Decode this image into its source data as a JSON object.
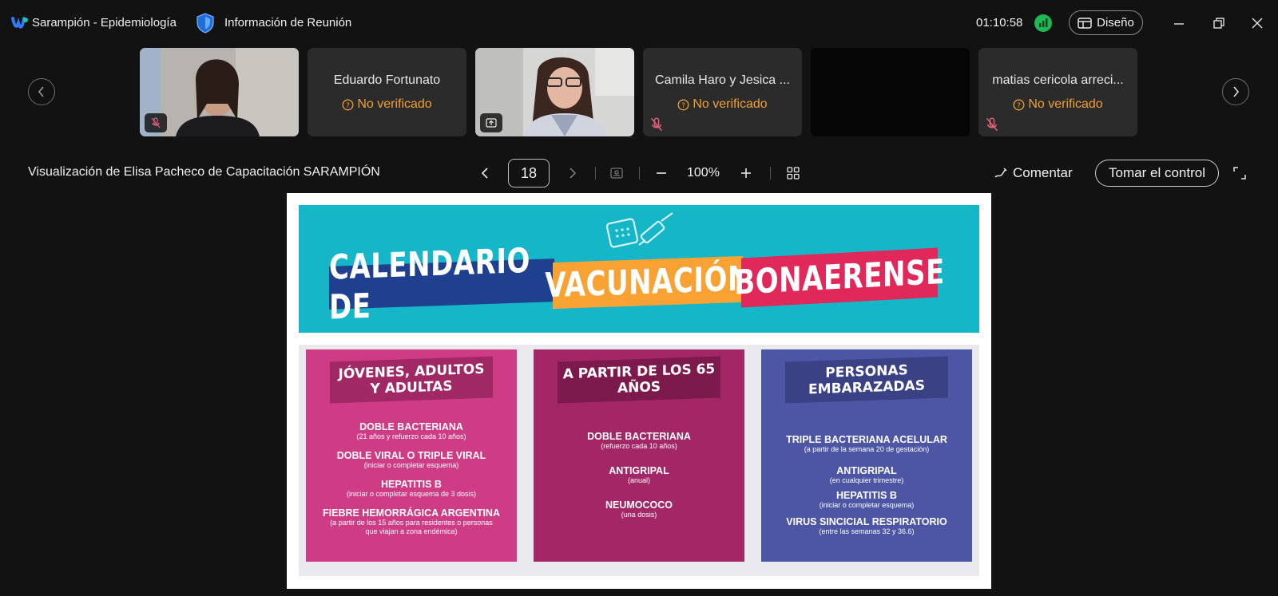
{
  "titlebar": {
    "app_title": "Sarampión - Epidemiología",
    "meeting_info": "Información de Reunión",
    "timer": "01:10:58",
    "layout_label": "Diseño"
  },
  "participants": [
    {
      "name": "",
      "status": "",
      "type": "video"
    },
    {
      "name": "Eduardo Fortunato",
      "status": "No verificado",
      "type": "name"
    },
    {
      "name": "",
      "status": "",
      "type": "video"
    },
    {
      "name": "Camila Haro y Jesica ...",
      "status": "No verificado",
      "type": "name"
    },
    {
      "name": "",
      "status": "",
      "type": "black"
    },
    {
      "name": "matias cericola  arreci...",
      "status": "No verificado",
      "type": "name"
    }
  ],
  "share": {
    "title": "Visualización de Elisa Pacheco de Capacitación SARAMPIÓN",
    "page": "18",
    "zoom": "100%",
    "comment_label": "Comentar",
    "control_label": "Tomar el control"
  },
  "slide": {
    "banner": [
      "CALENDARIO DE",
      "VACUNACIÓN",
      "BONAERENSE"
    ],
    "columns": [
      {
        "heading": "JÓVENES, ADULTOS Y ADULTAS",
        "items": [
          {
            "title": "DOBLE BACTERIANA",
            "note": "(21 años y refuerzo cada 10 años)"
          },
          {
            "title": "DOBLE VIRAL O TRIPLE VIRAL",
            "note": "(iniciar o completar esquema)"
          },
          {
            "title": "HEPATITIS B",
            "note": "(iniciar o completar esquema de 3 dosis)"
          },
          {
            "title": "FIEBRE HEMORRÁGICA ARGENTINA",
            "note": "(a partir de los 15 años para residentes o personas que viajan a zona endémica)"
          }
        ]
      },
      {
        "heading": "A PARTIR DE LOS 65 AÑOS",
        "items": [
          {
            "title": "DOBLE BACTERIANA",
            "note": "(refuerzo cada 10 años)"
          },
          {
            "title": "ANTIGRIPAL",
            "note": "(anual)"
          },
          {
            "title": "NEUMOCOCO",
            "note": "(una dosis)"
          }
        ]
      },
      {
        "heading": "PERSONAS EMBARAZADAS",
        "items": [
          {
            "title": "TRIPLE BACTERIANA ACELULAR",
            "note": "(a partir de la semana 20 de gestación)"
          },
          {
            "title": "ANTIGRIPAL",
            "note": "(en cualquier trimestre)"
          },
          {
            "title": "HEPATITIS B",
            "note": "(iniciar o completar esquema)"
          },
          {
            "title": "VIRUS SINCICIAL RESPIRATORIO",
            "note": "(entre las semanas 32 y 36.6)"
          }
        ]
      }
    ]
  }
}
